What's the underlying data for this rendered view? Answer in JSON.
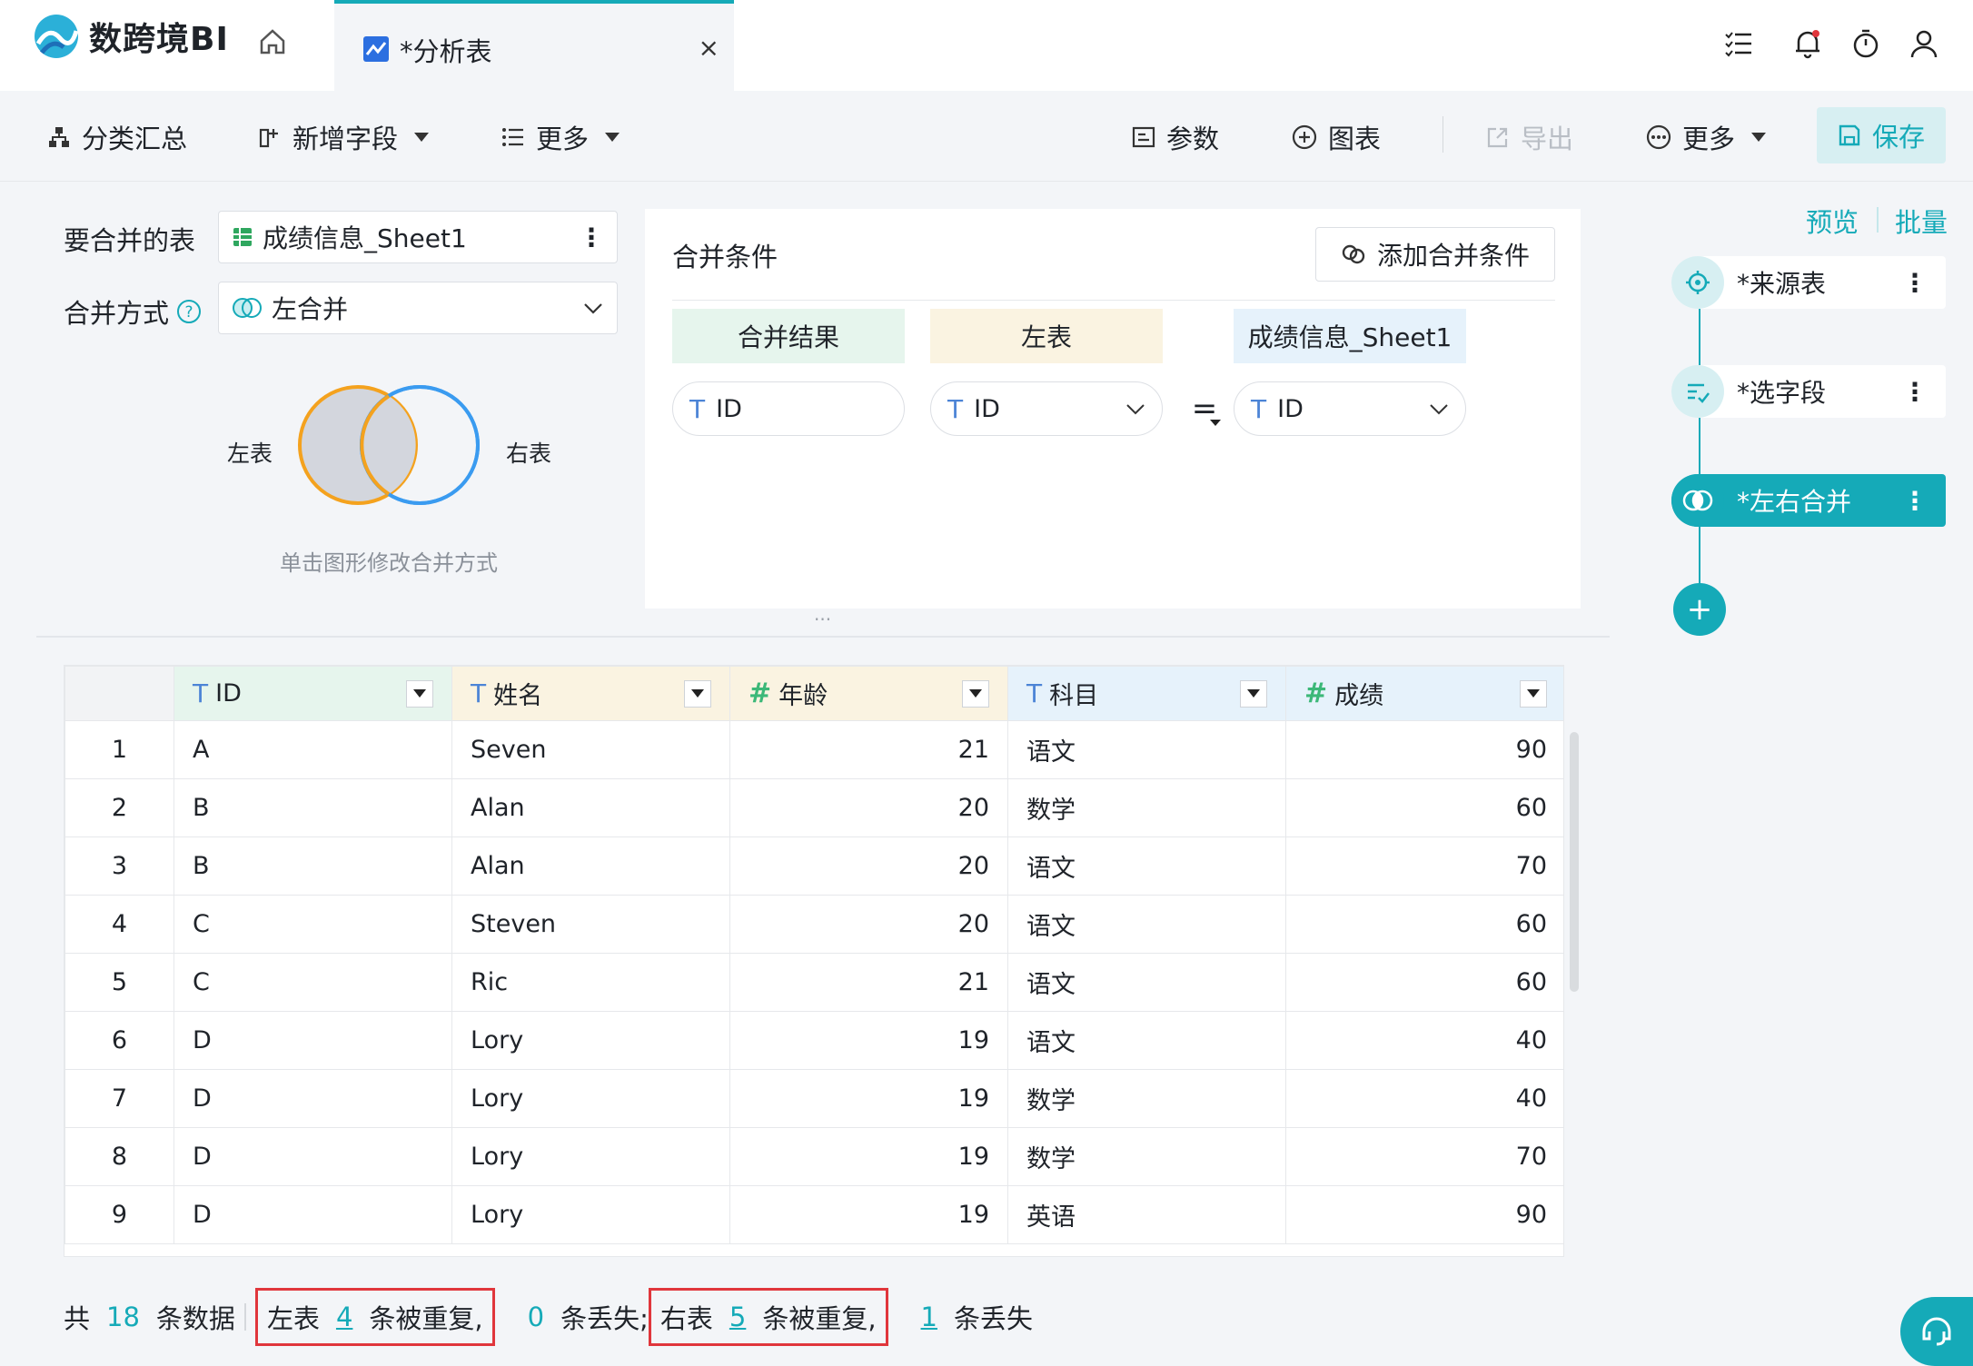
{
  "app": {
    "brand": "数跨境BI",
    "accent": "#15aab8"
  },
  "tab": {
    "title": "*分析表",
    "close": "×"
  },
  "toolbar": {
    "group_summary": "分类汇总",
    "add_field": "新增字段",
    "more_left": "更多",
    "params": "参数",
    "chart": "图表",
    "export": "导出",
    "more_right": "更多",
    "save": "保存"
  },
  "config": {
    "merge_table_label": "要合并的表",
    "merge_table_value": "成绩信息_Sheet1",
    "merge_mode_label": "合并方式",
    "merge_mode_value": "左合并",
    "venn_left": "左表",
    "venn_right": "右表",
    "venn_hint": "单击图形修改合并方式"
  },
  "conditions": {
    "title": "合并条件",
    "add_button": "添加合并条件",
    "col_result": "合并结果",
    "col_left": "左表",
    "col_right": "成绩信息_Sheet1",
    "result_field": "ID",
    "left_field": "ID",
    "operator": "=",
    "right_field": "ID"
  },
  "grid": {
    "splitter": "···",
    "columns": [
      {
        "label": "ID",
        "type": "T"
      },
      {
        "label": "姓名",
        "type": "T"
      },
      {
        "label": "年龄",
        "type": "#"
      },
      {
        "label": "科目",
        "type": "T"
      },
      {
        "label": "成绩",
        "type": "#"
      }
    ],
    "rows": [
      [
        "1",
        "A",
        "Seven",
        "21",
        "语文",
        "90"
      ],
      [
        "2",
        "B",
        "Alan",
        "20",
        "数学",
        "60"
      ],
      [
        "3",
        "B",
        "Alan",
        "20",
        "语文",
        "70"
      ],
      [
        "4",
        "C",
        "Steven",
        "20",
        "语文",
        "60"
      ],
      [
        "5",
        "C",
        "Ric",
        "21",
        "语文",
        "60"
      ],
      [
        "6",
        "D",
        "Lory",
        "19",
        "语文",
        "40"
      ],
      [
        "7",
        "D",
        "Lory",
        "19",
        "数学",
        "40"
      ],
      [
        "8",
        "D",
        "Lory",
        "19",
        "数学",
        "70"
      ],
      [
        "9",
        "D",
        "Lory",
        "19",
        "英语",
        "90"
      ]
    ]
  },
  "footer": {
    "total_prefix": "共",
    "total": "18",
    "total_suffix": "条数据",
    "left_label": "左表",
    "left_dup": "4",
    "dup_suffix": "条被重复,",
    "left_lost": "0",
    "lost_suffix_semi": "条丢失;",
    "right_label": "右表",
    "right_dup": "5",
    "right_lost": "1",
    "lost_suffix": "条丢失"
  },
  "side": {
    "preview": "预览",
    "batch": "批量",
    "steps": [
      "*来源表",
      "*选字段",
      "*左右合并"
    ],
    "add": "+"
  }
}
